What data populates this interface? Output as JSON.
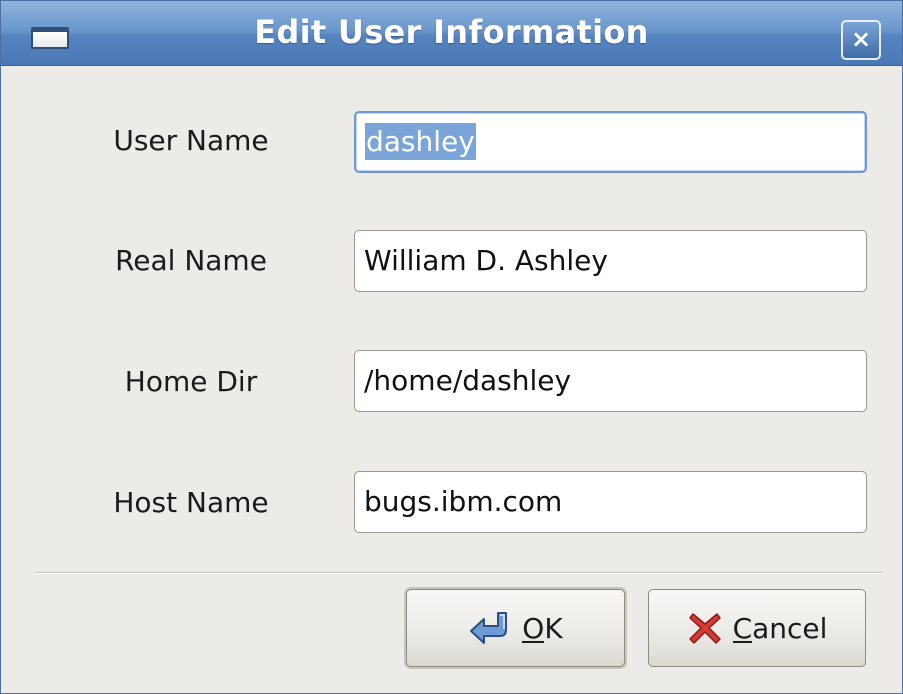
{
  "window": {
    "title": "Edit User Information",
    "close_symbol": "×"
  },
  "fields": [
    {
      "label": "User Name",
      "value": "dashley",
      "focused": true,
      "selected": true
    },
    {
      "label": "Real Name",
      "value": "William D. Ashley"
    },
    {
      "label": "Home Dir",
      "value": "/home/dashley"
    },
    {
      "label": "Host Name",
      "value": "bugs.ibm.com"
    }
  ],
  "buttons": {
    "ok_label": "OK",
    "ok_icon": "enter-arrow-icon",
    "cancel_label": "Cancel",
    "cancel_icon": "red-x-icon"
  },
  "colors": {
    "titlebar": "#5583bf",
    "selection": "#7ba5d9",
    "cancel_icon": "#d12f2f",
    "ok_icon": "#4f7fbf"
  }
}
